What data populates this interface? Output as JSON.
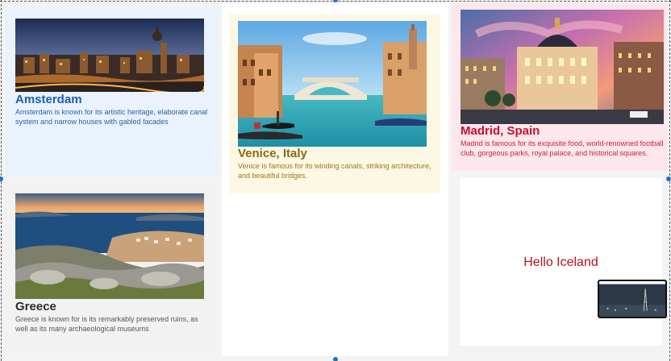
{
  "cards": {
    "amsterdam": {
      "title": "Amsterdam",
      "description": "Amsterdam is known for its artistic heritage, elaborate canal system and narrow houses with gabled facades",
      "color": "#1b5fb0",
      "background": "#e9f2fd"
    },
    "greece": {
      "title": "Greece",
      "description": "Greece is known for is its remarkably preserved ruins, as well as its many archaeological museums",
      "color": "#2b2b2b",
      "background": "#f2f2f2"
    },
    "venice": {
      "title": "Venice, Italy",
      "description": "Venice is famous for its winding canals, striking architecture, and beautiful bridges.",
      "color": "#8a6a10",
      "background": "#fdf8e3"
    },
    "madrid": {
      "title": "Madrid, Spain",
      "description": "Madrid is famous for its exquisite food, world-renowned football club, gorgeous parks, royal palace, and historical squares.",
      "color": "#c8102e",
      "background": "#fde7ec"
    },
    "iceland": {
      "text": "Hello Iceland",
      "color": "#b5121b"
    }
  },
  "selection": {
    "handle_color": "#1f6fd6"
  }
}
